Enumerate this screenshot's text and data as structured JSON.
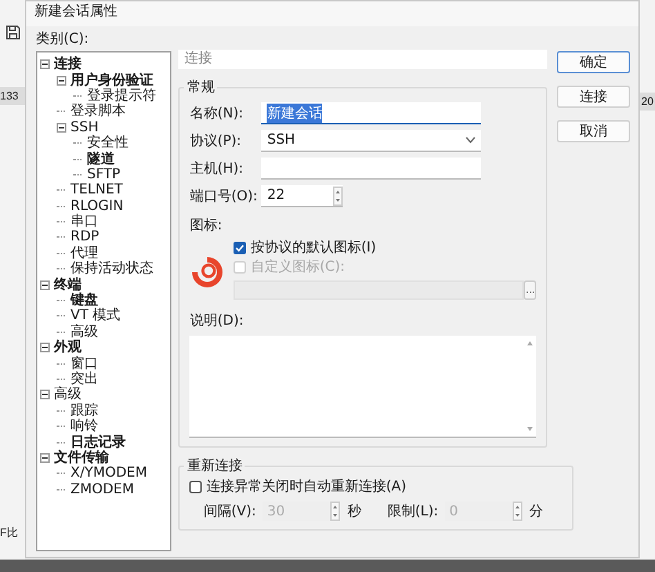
{
  "background": {
    "left_texts": [
      "133",
      "F比"
    ],
    "right_texts": [
      "20"
    ]
  },
  "window": {
    "title": "新建会话属性"
  },
  "category_label": "类别(C):",
  "tree": [
    {
      "label": "连接",
      "bold": true,
      "expanded": true,
      "children": [
        {
          "label": "用户身份验证",
          "bold": true,
          "expanded": true,
          "children": [
            {
              "label": "登录提示符",
              "bold": false
            }
          ]
        },
        {
          "label": "登录脚本",
          "bold": false
        },
        {
          "label": "SSH",
          "bold": false,
          "expanded": true,
          "children": [
            {
              "label": "安全性",
              "bold": false
            },
            {
              "label": "隧道",
              "bold": true
            },
            {
              "label": "SFTP",
              "bold": false
            }
          ]
        },
        {
          "label": "TELNET",
          "bold": false
        },
        {
          "label": "RLOGIN",
          "bold": false
        },
        {
          "label": "串口",
          "bold": false
        },
        {
          "label": "RDP",
          "bold": false
        },
        {
          "label": "代理",
          "bold": false
        },
        {
          "label": "保持活动状态",
          "bold": false
        }
      ]
    },
    {
      "label": "终端",
      "bold": true,
      "expanded": true,
      "children": [
        {
          "label": "键盘",
          "bold": true
        },
        {
          "label": "VT 模式",
          "bold": false
        },
        {
          "label": "高级",
          "bold": false
        }
      ]
    },
    {
      "label": "外观",
      "bold": true,
      "expanded": true,
      "children": [
        {
          "label": "窗口",
          "bold": false
        },
        {
          "label": "突出",
          "bold": false
        }
      ]
    },
    {
      "label": "高级",
      "bold": false,
      "expanded": true,
      "children": [
        {
          "label": "跟踪",
          "bold": false
        },
        {
          "label": "响铃",
          "bold": false
        },
        {
          "label": "日志记录",
          "bold": true
        }
      ]
    },
    {
      "label": "文件传输",
      "bold": true,
      "expanded": true,
      "children": [
        {
          "label": "X/YMODEM",
          "bold": false
        },
        {
          "label": "ZMODEM",
          "bold": false
        }
      ]
    }
  ],
  "section_header": "连接",
  "general": {
    "title": "常规",
    "fields": [
      {
        "kind": "text",
        "label": "名称(N):",
        "value": "新建会话",
        "value_selected": true
      },
      {
        "kind": "select",
        "label": "协议(P):",
        "value": "SSH",
        "value_selected": false
      },
      {
        "kind": "text",
        "label": "主机(H):",
        "value_selected": false
      },
      {
        "kind": "spin",
        "label": "端口号(O):",
        "value": "22",
        "value_selected": false
      }
    ],
    "icon_label": "图标:",
    "icon_options": [
      {
        "label": "按协议的默认图标(I)",
        "checked": true,
        "disabled": false
      },
      {
        "label": "自定义图标(C):",
        "checked": false,
        "disabled": true
      }
    ],
    "icon_path": {
      "disabled": true,
      "browse": "..."
    },
    "description_label": "说明(D):"
  },
  "reconnect": {
    "title": "重新连接",
    "checkbox": {
      "label": "连接异常关闭时自动重新连接(A)",
      "checked": false
    },
    "spins": [
      {
        "label": "间隔(V):",
        "value": "30",
        "unit": "秒",
        "disabled": true
      },
      {
        "label": "限制(L):",
        "value": "0",
        "unit": "分",
        "disabled": true
      }
    ]
  },
  "buttons": [
    {
      "label": "确定",
      "default": true
    },
    {
      "label": "连接",
      "default": false
    },
    {
      "label": "取消",
      "default": false
    }
  ]
}
